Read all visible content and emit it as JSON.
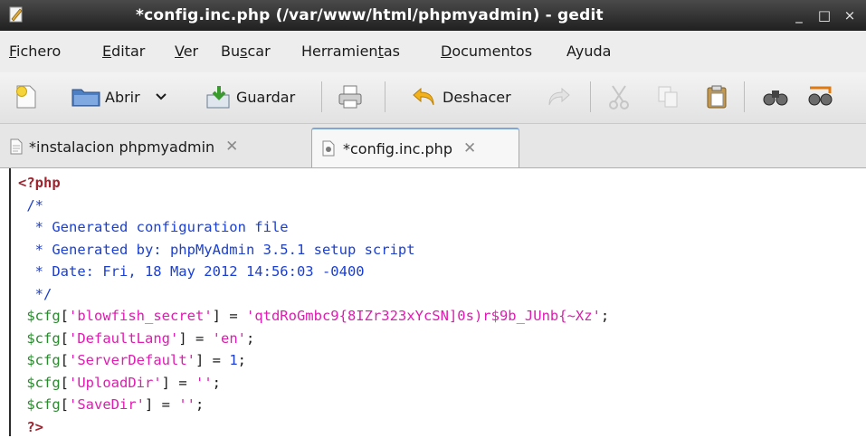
{
  "window": {
    "title": "*config.inc.php (/var/www/html/phpmyadmin) - gedit",
    "minimize": "_",
    "maximize": "□",
    "close": "×"
  },
  "menu": {
    "items": [
      "Fichero",
      "Editar",
      "Ver",
      "Buscar",
      "Herramientas",
      "Documentos",
      "Ayuda"
    ]
  },
  "toolbar": {
    "open_label": "Abrir",
    "save_label": "Guardar",
    "undo_label": "Deshacer",
    "icons": [
      "new-document-icon",
      "open-folder-icon",
      "dropdown-arrow-icon",
      "save-icon",
      "print-icon",
      "undo-icon",
      "redo-icon",
      "cut-icon",
      "copy-icon",
      "paste-icon",
      "find-icon",
      "find-replace-icon"
    ]
  },
  "tabs": [
    {
      "label": "*instalacion phpmyadmin",
      "active": false
    },
    {
      "label": "*config.inc.php",
      "active": true
    }
  ],
  "editor": {
    "lines": [
      "<?php",
      " /*",
      "  * Generated configuration file",
      "  * Generated by: phpMyAdmin 3.5.1 setup script",
      "  * Date: Fri, 18 May 2012 14:56:03 -0400",
      "  */",
      " $cfg['blowfish_secret'] = 'qtdRoGmbc9{8IZr323xYcSN]0s)r$9b_JUnb{~Xz';",
      " $cfg['DefaultLang'] = 'en';",
      " $cfg['ServerDefault'] = 1;",
      " $cfg['UploadDir'] = '';",
      " $cfg['SaveDir'] = '';",
      " ?>"
    ]
  },
  "colors": {
    "keyword": "#a0232e",
    "comment": "#1a3fd1",
    "variable": "#2a8a2e",
    "string": "#e01bb1"
  }
}
